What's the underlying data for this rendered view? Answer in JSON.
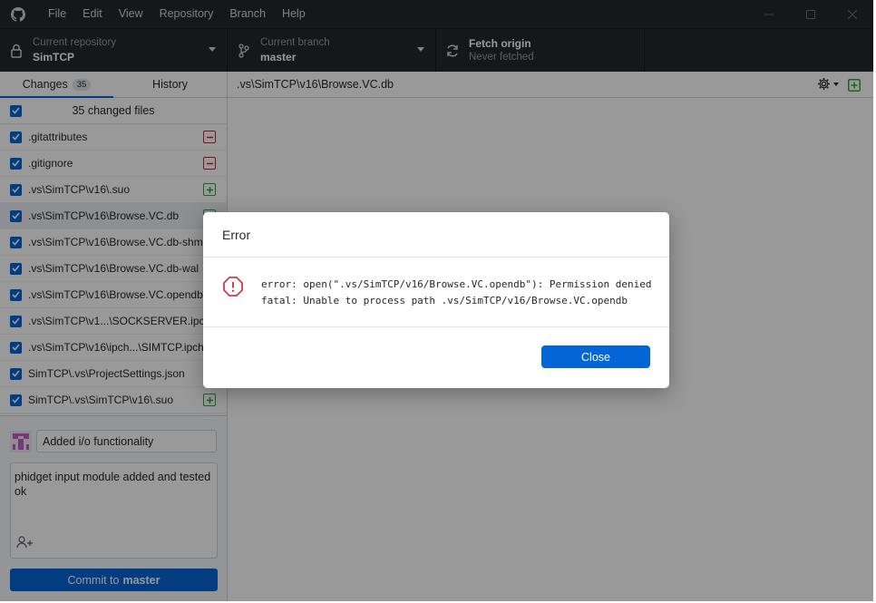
{
  "menu": [
    "File",
    "Edit",
    "View",
    "Repository",
    "Branch",
    "Help"
  ],
  "toolbar": {
    "repo_label": "Current repository",
    "repo_value": "SimTCP",
    "branch_label": "Current branch",
    "branch_value": "master",
    "fetch_label": "Fetch origin",
    "fetch_status": "Never fetched"
  },
  "tabs": {
    "changes_label": "Changes",
    "changes_count": "35",
    "history_label": "History"
  },
  "changed_files_label": "35 changed files",
  "files": [
    {
      "name": ".gitattributes",
      "status": "deleted"
    },
    {
      "name": ".gitignore",
      "status": "deleted"
    },
    {
      "name": ".vs\\SimTCP\\v16\\.suo",
      "status": "added"
    },
    {
      "name": ".vs\\SimTCP\\v16\\Browse.VC.db",
      "status": "added"
    },
    {
      "name": ".vs\\SimTCP\\v16\\Browse.VC.db-shm",
      "status": "added"
    },
    {
      "name": ".vs\\SimTCP\\v16\\Browse.VC.db-wal",
      "status": "added"
    },
    {
      "name": ".vs\\SimTCP\\v16\\Browse.VC.opendb",
      "status": "added"
    },
    {
      "name": ".vs\\SimTCP\\v1...\\SOCKSERVER.ipch",
      "status": "added"
    },
    {
      "name": ".vs\\SimTCP\\v16\\ipch...\\SIMTCP.ipch",
      "status": "added"
    },
    {
      "name": "SimTCP\\.vs\\ProjectSettings.json",
      "status": "added"
    },
    {
      "name": "SimTCP\\.vs\\SimTCP\\v16\\.suo",
      "status": "added"
    }
  ],
  "commit": {
    "summary": "Added i/o functionality",
    "description": "phidget input module added and tested ok",
    "button_prefix": "Commit to",
    "button_branch": "master"
  },
  "diff_path": ".vs\\SimTCP\\v16\\Browse.VC.db",
  "dialog": {
    "title": "Error",
    "message_line1": "error: open(\".vs/SimTCP/v16/Browse.VC.opendb\"): Permission denied",
    "message_line2": "fatal: Unable to process path .vs/SimTCP/v16/Browse.VC.opendb",
    "close_label": "Close"
  },
  "colors": {
    "accent": "#0366d6",
    "deleted": "#cb2431",
    "added": "#28a745",
    "error": "#d73a49",
    "titlebar": "#24292e"
  }
}
